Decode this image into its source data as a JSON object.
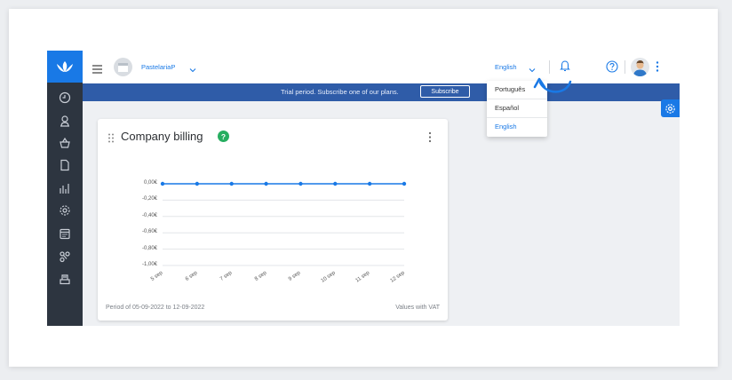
{
  "topbar": {
    "company_name": "PastelariaP",
    "language_selected": "English"
  },
  "language_menu": {
    "options": [
      "Português",
      "Español",
      "English"
    ]
  },
  "trial_banner": {
    "text": "Trial period. Subscribe one of our plans.",
    "button_label": "Subscribe"
  },
  "widget": {
    "title": "Company billing",
    "help_symbol": "?",
    "period_text": "Period of 05-09-2022 to 12-09-2022",
    "vat_note": "Values with VAT"
  },
  "colors": {
    "accent": "#1979e6",
    "sidebar": "#2d3540",
    "banner": "#2f5ca8",
    "badge": "#27ae60"
  },
  "chart_data": {
    "type": "line",
    "categories": [
      "5 sep",
      "6 sep",
      "7 sep",
      "8 sep",
      "9 sep",
      "10 sep",
      "11 sep",
      "12 sep"
    ],
    "series": [
      {
        "values": [
          0,
          0,
          0,
          0,
          0,
          0,
          0,
          0
        ]
      }
    ],
    "y_ticks": [
      "0,00€",
      "-0,20€",
      "-0,40€",
      "-0,60€",
      "-0,80€",
      "-1,00€"
    ],
    "ylim": [
      -1,
      0
    ],
    "grid": true
  }
}
